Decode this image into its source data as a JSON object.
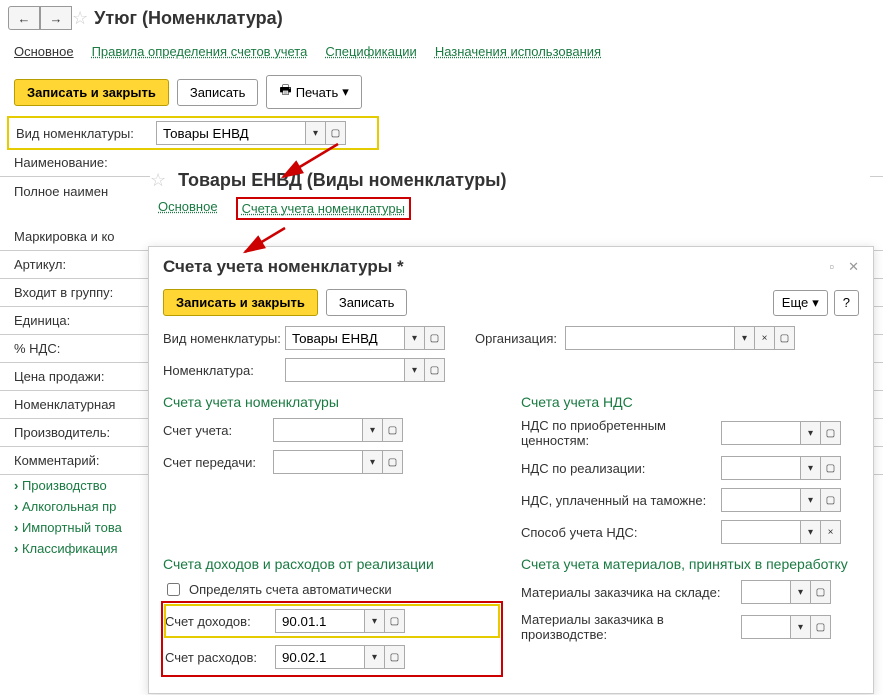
{
  "header": {
    "title": "Утюг (Номенклатура)"
  },
  "tabs": {
    "main": "Основное",
    "rules": "Правила определения счетов учета",
    "specs": "Спецификации",
    "usage": "Назначения использования"
  },
  "actions": {
    "save_close": "Записать и закрыть",
    "save": "Записать",
    "print": "Печать"
  },
  "form": {
    "nomenclature_type_label": "Вид номенклатуры:",
    "nomenclature_type_value": "Товары ЕНВД",
    "name_label": "Наименование:",
    "full_name_label": "Полное наимен",
    "marking_label": "Маркировка и ко",
    "article_label": "Артикул:",
    "group_label": "Входит в группу:",
    "unit_label": "Единица:",
    "vat_label": "% НДС:",
    "price_label": "Цена продажи:",
    "nom_group_label": "Номенклатурная",
    "manufacturer_label": "Производитель:",
    "comment_label": "Комментарий:"
  },
  "tree": {
    "production": "Производство",
    "alcohol": "Алкогольная пр",
    "imported": "Импортный това",
    "classification": "Классификация"
  },
  "modal1": {
    "title": "Товары ЕНВД (Виды номенклатуры)",
    "tab_main": "Основное",
    "tab_accounts": "Счета учета номенклатуры"
  },
  "modal2": {
    "title": "Счета учета номенклатуры *",
    "save_close": "Записать и закрыть",
    "save": "Записать",
    "more": "Еще",
    "help": "?",
    "nom_type_label": "Вид номенклатуры:",
    "nom_type_value": "Товары ЕНВД",
    "org_label": "Организация:",
    "nom_label": "Номенклатура:",
    "section_accounts": "Счета учета номенклатуры",
    "account_label": "Счет учета:",
    "transfer_label": "Счет передачи:",
    "section_vat": "Счета учета НДС",
    "vat_purchase_label": "НДС по приобретенным ценностям:",
    "vat_sale_label": "НДС по реализации:",
    "vat_customs_label": "НДС, уплаченный на таможне:",
    "vat_method_label": "Способ учета НДС:",
    "section_income": "Счета доходов и расходов от реализации",
    "auto_accounts_label": "Определять счета автоматически",
    "income_label": "Счет доходов:",
    "income_value": "90.01.1",
    "expense_label": "Счет расходов:",
    "expense_value": "90.02.1",
    "section_materials": "Счета учета материалов, принятых в переработку",
    "mat_warehouse_label": "Материалы заказчика на складе:",
    "mat_production_label": "Материалы заказчика в производстве:"
  }
}
